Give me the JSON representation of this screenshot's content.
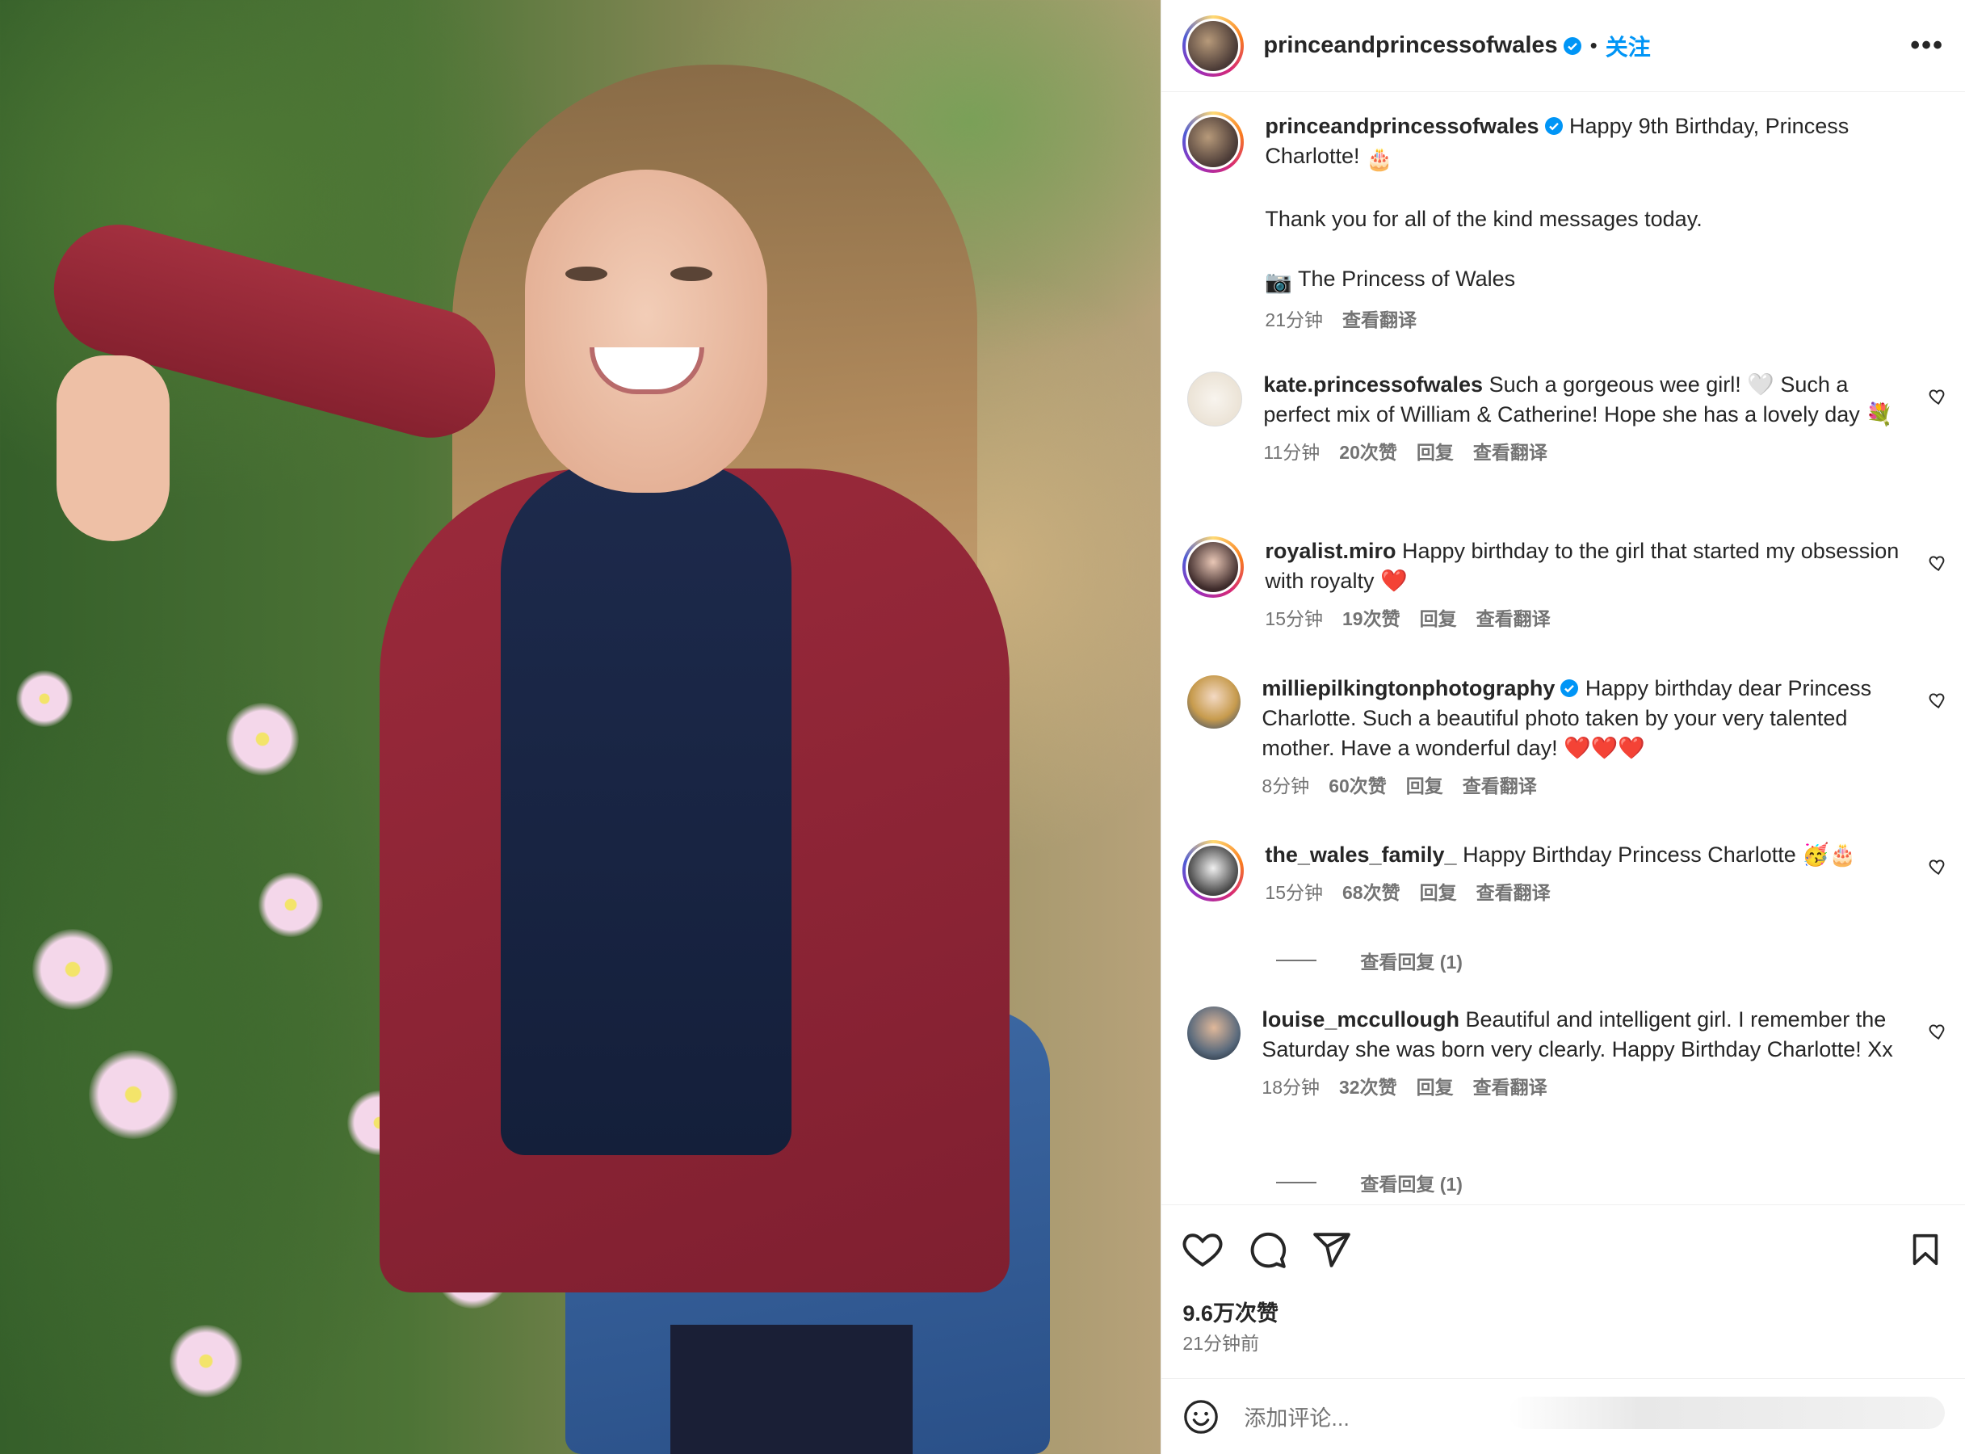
{
  "post": {
    "username": "princeandprincessofwales",
    "follow_label": "关注",
    "more_label": "•••",
    "caption_line1": "Happy 9th Birthday, Princess Charlotte!",
    "caption_line2": "Thank you for all of the kind messages today.",
    "caption_line3": "The Princess of Wales",
    "caption_time": "21分钟",
    "caption_translate": "查看翻译"
  },
  "comments": [
    {
      "user": "kate.princessofwales",
      "text": "Such a gorgeous wee girl! 🤍 Such a perfect mix of William & Catherine! Hope she has a lovely day 💐",
      "time": "11分钟",
      "likes": "20次赞",
      "reply": "回复",
      "translate": "查看翻译"
    },
    {
      "user": "royalist.miro",
      "text": "Happy birthday to the girl that started my obsession with royalty ❤️",
      "time": "15分钟",
      "likes": "19次赞",
      "reply": "回复",
      "translate": "查看翻译"
    },
    {
      "user": "milliepilkingtonphotography",
      "text": "Happy birthday dear Princess Charlotte. Such a beautiful photo taken by your very talented mother. Have a wonderful day! ❤️❤️❤️",
      "time": "8分钟",
      "likes": "60次赞",
      "reply": "回复",
      "translate": "查看翻译"
    },
    {
      "user": "the_wales_family_",
      "text": "Happy Birthday Princess Charlotte 🥳🎂",
      "time": "15分钟",
      "likes": "68次赞",
      "reply": "回复",
      "translate": "查看翻译",
      "view_replies": "查看回复 (1)"
    },
    {
      "user": "louise_mccullough",
      "text": "Beautiful and intelligent girl. I remember the Saturday she was born very clearly. Happy Birthday Charlotte! Xx",
      "time": "18分钟",
      "likes": "32次赞",
      "reply": "回复",
      "translate": "查看翻译",
      "view_replies": "查看回复 (1)"
    }
  ],
  "footer": {
    "likes": "9.6万次赞",
    "posted": "21分钟前",
    "add_comment_placeholder": "添加评论..."
  },
  "colors": {
    "accent": "#0095f6",
    "text": "#262626",
    "muted": "#737373",
    "verified": "#0095f6"
  },
  "icons": [
    "heart-icon",
    "comment-icon",
    "share-icon",
    "bookmark-icon",
    "smile-icon",
    "more-icon",
    "verified-badge-icon"
  ]
}
